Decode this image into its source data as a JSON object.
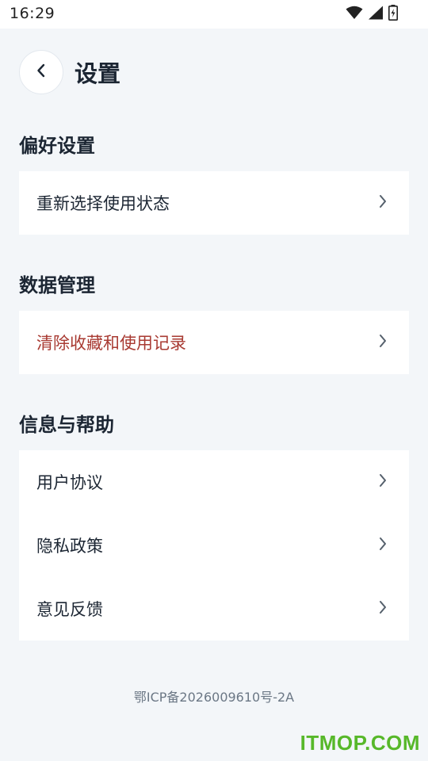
{
  "status_bar": {
    "time": "16:29",
    "icons": [
      "wifi-icon",
      "signal-icon",
      "battery-charging-icon"
    ]
  },
  "header": {
    "back_icon": "chevron-left-icon",
    "title": "设置"
  },
  "sections": [
    {
      "title": "偏好设置",
      "items": [
        {
          "label": "重新选择使用状态"
        }
      ]
    },
    {
      "title": "数据管理",
      "items": [
        {
          "label": "清除收藏和使用记录",
          "color": "#a83a32"
        }
      ]
    },
    {
      "title": "信息与帮助",
      "items": [
        {
          "label": "用户协议"
        },
        {
          "label": "隐私政策"
        },
        {
          "label": "意见反馈"
        }
      ]
    }
  ],
  "footer": {
    "icp": "鄂ICP备2026009610号-2A"
  },
  "watermark": "ITMOP.COM",
  "colors": {
    "background": "#f3f6f9",
    "card": "#ffffff",
    "text": "#1c2633",
    "danger": "#a83a32",
    "watermark": "#57b82a"
  }
}
